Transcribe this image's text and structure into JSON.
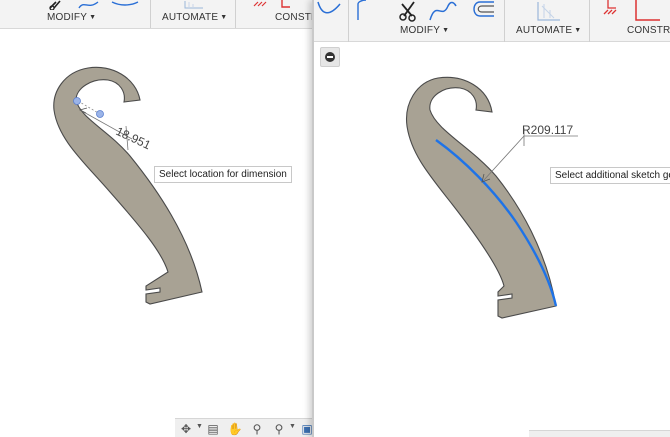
{
  "left": {
    "toolbar": {
      "modify_label": "MODIFY",
      "automate_label": "AUTOMATE",
      "constrain_label": "CONSTR"
    },
    "dimension_value": "18.951",
    "tooltip": "Select location for dimension",
    "icons": [
      "scissors-icon",
      "spline-icon",
      "offset-icon",
      "automate-icon",
      "constraint-icon"
    ]
  },
  "right": {
    "toolbar": {
      "modify_label": "MODIFY",
      "automate_label": "AUTOMATE",
      "constrain_label": "CONSTRA"
    },
    "dimension_value": "R209.117",
    "tooltip": "Select additional sketch ge",
    "icons": [
      "scissors-icon",
      "spline-icon",
      "offset-icon",
      "automate-icon",
      "constraint-icon",
      "collapse-icon"
    ]
  },
  "nav": {
    "icons": [
      "orbit-icon",
      "look-at-icon",
      "pan-icon",
      "zoom-icon",
      "zoom-window-icon",
      "display-icon"
    ]
  },
  "colors": {
    "shape_fill": "#a8a294",
    "shape_stroke": "#4a4a4a",
    "selection": "#1e73e8",
    "toolbar_bg": "#f3f3f3"
  }
}
